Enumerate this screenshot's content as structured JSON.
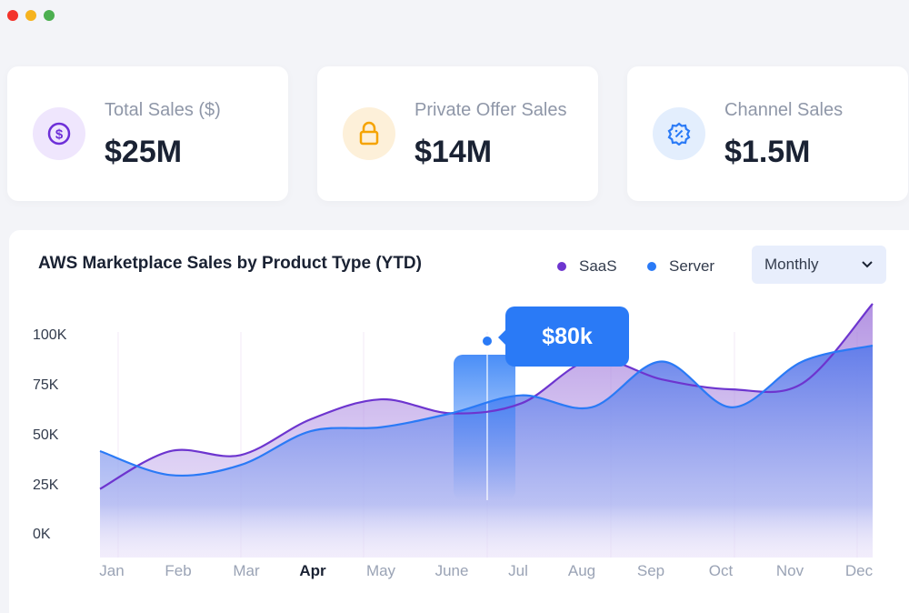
{
  "window": {
    "controls": [
      "close",
      "minimize",
      "maximize"
    ]
  },
  "cards": [
    {
      "label": "Total Sales ($)",
      "value": "$25M",
      "icon": "dollar-circle-icon",
      "icon_color": "#6d2fd8",
      "icon_bg": "#efe6fd"
    },
    {
      "label": "Private Offer Sales",
      "value": "$14M",
      "icon": "lock-icon",
      "icon_color": "#f5a300",
      "icon_bg": "#fdf0d9"
    },
    {
      "label": "Channel Sales",
      "value": "$1.5M",
      "icon": "discount-badge-icon",
      "icon_color": "#2a7af6",
      "icon_bg": "#e3eefd"
    }
  ],
  "chart_data": {
    "type": "area",
    "title": "AWS Marketplace Sales by Product Type (YTD)",
    "period_select": "Monthly",
    "categories": [
      "Jan",
      "Feb",
      "Mar",
      "Apr",
      "May",
      "June",
      "Jul",
      "Aug",
      "Sep",
      "Oct",
      "Nov",
      "Dec"
    ],
    "active_category": "Apr",
    "yticks": [
      "100K",
      "75K",
      "50K",
      "25K",
      "0K"
    ],
    "ylim": [
      0,
      100000
    ],
    "grid": "vertical",
    "legend": "top-right",
    "series": [
      {
        "name": "SaaS",
        "color": "#6d35cf",
        "values": [
          23000,
          42000,
          40000,
          58000,
          68000,
          61000,
          66000,
          88000,
          78000,
          73000,
          76000,
          116000
        ]
      },
      {
        "name": "Server",
        "color": "#2a7af6",
        "values": [
          42000,
          30000,
          35000,
          52000,
          54000,
          61000,
          70000,
          64000,
          87000,
          64000,
          87000,
          95000
        ]
      }
    ],
    "tooltip": {
      "label": "$80k",
      "between": [
        "June",
        "Jul"
      ]
    }
  }
}
